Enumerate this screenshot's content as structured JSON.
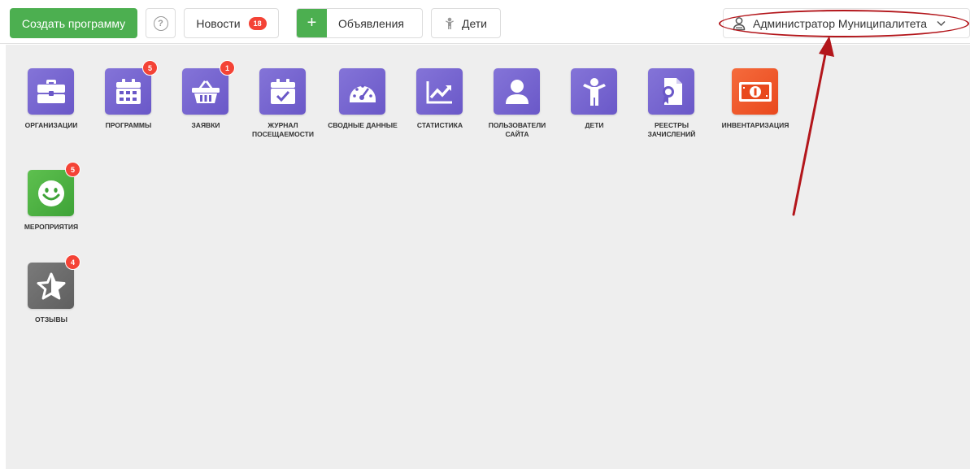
{
  "header": {
    "create_label": "Создать программу",
    "help_label": "?",
    "news_label": "Новости",
    "news_badge": "18",
    "ads_plus": "+",
    "ads_label": "Объявления",
    "kids_label": "Дети",
    "user_name": "Администратор Муниципалитета"
  },
  "tiles": [
    {
      "label": "Организации",
      "icon": "briefcase-icon"
    },
    {
      "label": "Программы",
      "icon": "calendar-grid-icon",
      "badge": "5"
    },
    {
      "label": "Заявки",
      "icon": "basket-icon",
      "badge": "1"
    },
    {
      "label": "Журнал посещаемости",
      "icon": "calendar-check-icon"
    },
    {
      "label": "Сводные данные",
      "icon": "gauge-icon"
    },
    {
      "label": "Статистика",
      "icon": "chart-line-icon"
    },
    {
      "label": "Пользователи сайта",
      "icon": "user-icon"
    },
    {
      "label": "Дети",
      "icon": "child-icon"
    },
    {
      "label": "Реестры зачислений",
      "icon": "certificate-icon"
    },
    {
      "label": "Инвентаризация",
      "icon": "banknote-icon"
    },
    {
      "label": "Мероприятия",
      "icon": "smiley-icon",
      "badge": "5"
    },
    {
      "label": "Отзывы",
      "icon": "star-icon",
      "badge": "4"
    }
  ],
  "colors": {
    "accent_green": "#4caf50",
    "tile_purple": "#7566d2",
    "tile_orange": "#f05a2c",
    "tile_green": "#4db542",
    "tile_gray": "#6b6b6b",
    "badge_red": "#f44336",
    "annotation_red": "#b3161b"
  }
}
